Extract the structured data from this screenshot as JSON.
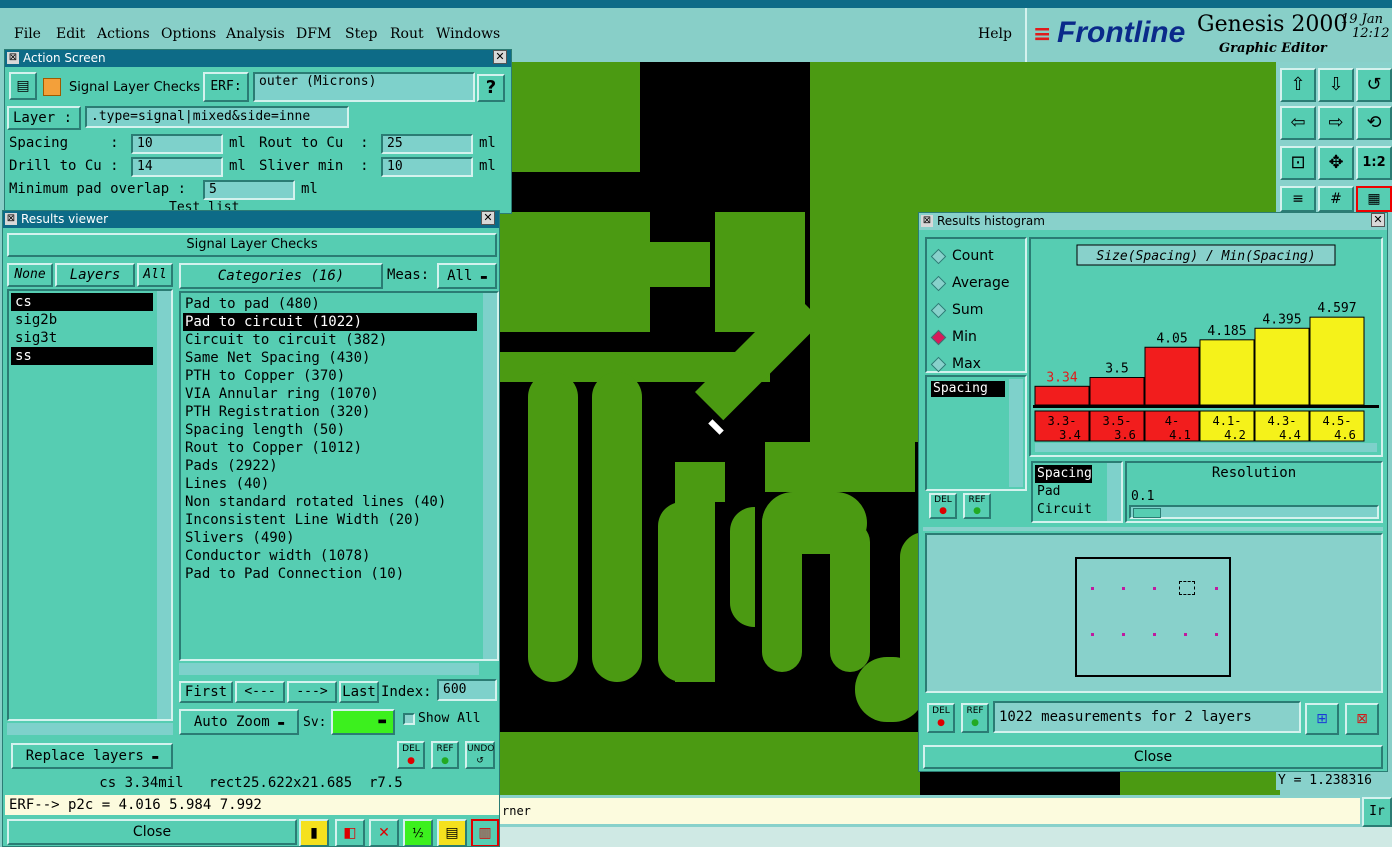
{
  "menubar": {
    "items": [
      "File",
      "Edit",
      "Actions",
      "Options",
      "Analysis",
      "DFM",
      "Step",
      "Rout",
      "Windows"
    ],
    "help": "Help"
  },
  "branding": {
    "logo": "Frontline",
    "product": "Genesis 2000",
    "subtitle": "Graphic Editor",
    "date": "19 Jan",
    "time": "12:12"
  },
  "action_screen": {
    "title": "Action Screen",
    "header": "Signal Layer Checks",
    "erf_label": "ERF:",
    "erf_value": "outer (Microns)",
    "help_btn": "?",
    "layer_btn": "Layer  :",
    "layer_value": ".type=signal|mixed&side=inne",
    "spacing_label": "Spacing     :",
    "spacing_value": "10",
    "rout_label": "Rout to Cu  :",
    "rout_value": "25",
    "drill_label": "Drill to Cu :",
    "drill_value": "14",
    "sliver_label": "Sliver min  :",
    "sliver_value": "10",
    "unit": "ml",
    "overlap_label": "Minimum pad overlap :",
    "overlap_value": "5",
    "test_list": "Test list"
  },
  "results_viewer": {
    "title": "Results viewer",
    "header": "Signal Layer Checks",
    "none_btn": "None",
    "layers_btn": "Layers",
    "all_btn": "All",
    "layers": [
      {
        "name": "cs",
        "selected": true
      },
      {
        "name": "sig2b",
        "selected": false
      },
      {
        "name": "sig3t",
        "selected": false
      },
      {
        "name": "ss",
        "selected": true
      }
    ],
    "categories_btn": "Categories (16)",
    "meas_label": "Meas:",
    "meas_value": "All",
    "categories": [
      {
        "label": "Pad to pad (480)",
        "selected": false
      },
      {
        "label": "Pad to circuit (1022)",
        "selected": true
      },
      {
        "label": "Circuit to circuit (382)",
        "selected": false
      },
      {
        "label": "Same Net Spacing (430)",
        "selected": false
      },
      {
        "label": "PTH to Copper (370)",
        "selected": false
      },
      {
        "label": "VIA Annular ring (1070)",
        "selected": false
      },
      {
        "label": "PTH Registration (320)",
        "selected": false
      },
      {
        "label": "Spacing length (50)",
        "selected": false
      },
      {
        "label": "Rout to Copper (1012)",
        "selected": false
      },
      {
        "label": "Pads (2922)",
        "selected": false
      },
      {
        "label": "Lines (40)",
        "selected": false
      },
      {
        "label": "Non standard rotated lines (40)",
        "selected": false
      },
      {
        "label": "Inconsistent Line Width (20)",
        "selected": false
      },
      {
        "label": "Slivers (490)",
        "selected": false
      },
      {
        "label": "Conductor width (1078)",
        "selected": false
      },
      {
        "label": "Pad to Pad Connection (10)",
        "selected": false
      }
    ],
    "first_btn": "First",
    "prev_btn": "<---",
    "next_btn": "--->",
    "last_btn": "Last",
    "index_label": "Index:",
    "index_value": "600",
    "autozoom_btn": "Auto Zoom",
    "sv_label": "Sv:",
    "show_all": "Show All",
    "replace_btn": "Replace layers",
    "del": "DEL",
    "ref": "REF",
    "undo": "UNDO",
    "status_line": "cs 3.34mil   rect25.622x21.685  r7.5",
    "erf_line": "ERF--> p2c = 4.016 5.984 7.992",
    "close_btn": "Close"
  },
  "histogram": {
    "title": "Results histogram",
    "options": [
      {
        "label": "Count",
        "on": false
      },
      {
        "label": "Average",
        "on": false
      },
      {
        "label": "Sum",
        "on": false
      },
      {
        "label": "Min",
        "on": true
      },
      {
        "label": "Max",
        "on": false
      }
    ],
    "list_item": "Spacing",
    "chart_title": "Size(Spacing) / Min(Spacing)",
    "measure_list": [
      "Spacing",
      "Pad",
      "Circuit"
    ],
    "resolution_label": "Resolution",
    "resolution_value": "0.1",
    "summary": "1022 measurements for 2 layers",
    "close_btn": "Close",
    "del": "DEL",
    "ref": "REF"
  },
  "chart_data": {
    "type": "bar",
    "title": "Size(Spacing) / Min(Spacing)",
    "categories": [
      "3.3-3.4",
      "3.5-3.6",
      "4-4.1",
      "4.1-4.2",
      "4.3-4.4",
      "4.5-4.6"
    ],
    "values": [
      3.34,
      3.5,
      4.05,
      4.185,
      4.395,
      4.597
    ],
    "value_labels": [
      "3.34",
      "3.5",
      "4.05",
      "4.185",
      "4.395",
      "4.597"
    ],
    "bar_colors": [
      "#f21d1d",
      "#f21d1d",
      "#f21d1d",
      "#f5f21a",
      "#f5f21a",
      "#f5f21a"
    ],
    "label_colors": [
      "#e01b1b",
      "#000000",
      "#000000",
      "#000000",
      "#000000",
      "#000000"
    ],
    "cat_label_top": [
      "3.3-",
      "3.5-",
      "4-",
      "4.1-",
      "4.3-",
      "4.5-"
    ],
    "cat_label_bottom": [
      "3.4",
      "3.6",
      "4.1",
      "4.2",
      "4.4",
      "4.6"
    ]
  },
  "canvas": {
    "readout": "Y = 1.238316",
    "status_text": "rner",
    "right_btn": "Ir"
  },
  "colors": {
    "copper": "#4b9a12",
    "substrate": "#000000",
    "panel": "#56cdb2",
    "titlebar": "#0d6b87",
    "selection": "#000000"
  }
}
